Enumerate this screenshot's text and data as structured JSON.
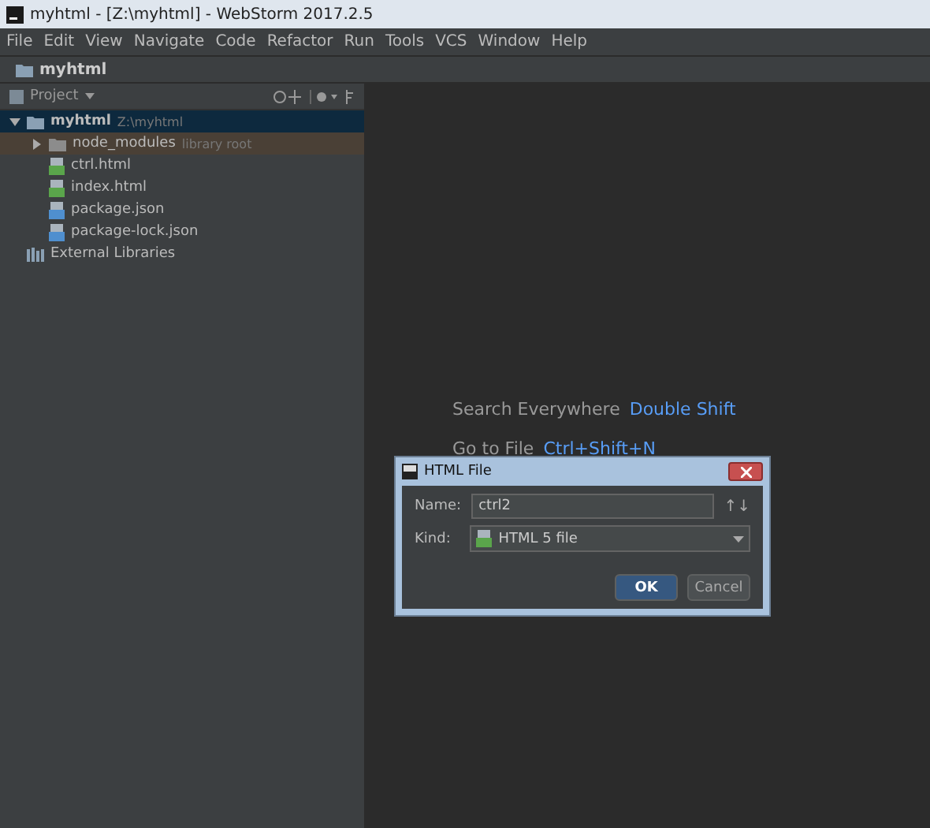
{
  "window": {
    "title": "myhtml - [Z:\\myhtml] - WebStorm 2017.2.5"
  },
  "menu": [
    "File",
    "Edit",
    "View",
    "Navigate",
    "Code",
    "Refactor",
    "Run",
    "Tools",
    "VCS",
    "Window",
    "Help"
  ],
  "breadcrumb": "myhtml",
  "project_panel": {
    "title": "Project",
    "tree": [
      {
        "label": "myhtml",
        "hint": "Z:\\myhtml",
        "kind": "folder",
        "expanded": true,
        "selected": true,
        "children": [
          {
            "label": "node_modules",
            "hint": "library root",
            "kind": "library-folder",
            "expanded": false,
            "selected": false
          },
          {
            "label": "ctrl.html",
            "kind": "html",
            "selected": false
          },
          {
            "label": "index.html",
            "kind": "html",
            "selected": false
          },
          {
            "label": "package.json",
            "kind": "json",
            "selected": false
          },
          {
            "label": "package-lock.json",
            "kind": "json",
            "selected": false
          }
        ]
      },
      {
        "label": "External Libraries",
        "kind": "libraries",
        "selected": false
      }
    ]
  },
  "editor_hints": [
    {
      "action": "Search Everywhere",
      "shortcut": "Double Shift"
    },
    {
      "action": "Go to File",
      "shortcut": "Ctrl+Shift+N"
    }
  ],
  "dialog": {
    "title": "HTML File",
    "fields": [
      {
        "label": "Name:",
        "value": "ctrl2",
        "kind": "text"
      },
      {
        "label": "Kind:",
        "value": "HTML 5 file",
        "kind": "select"
      }
    ],
    "sort_glyph": "↑↓",
    "buttons": [
      {
        "label": "OK",
        "default": true
      },
      {
        "label": "Cancel",
        "default": false
      }
    ]
  }
}
